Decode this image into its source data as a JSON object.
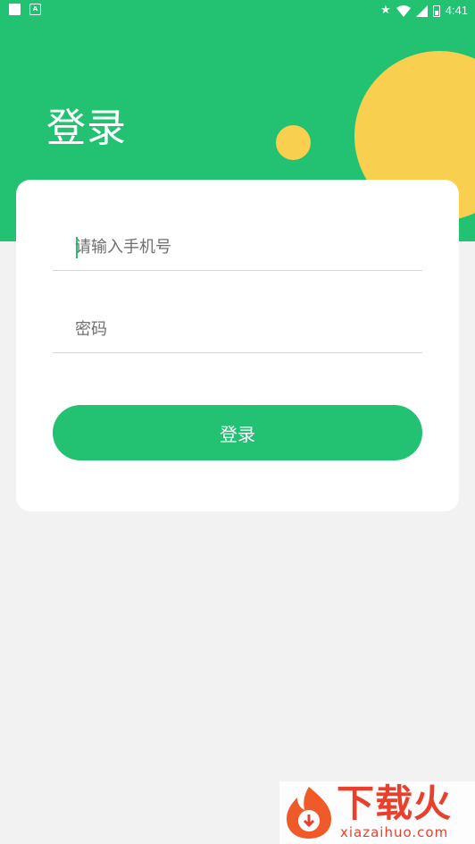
{
  "statusbar": {
    "time": "4:41",
    "icons": [
      "notification-square-icon",
      "accessibility-a-icon",
      "star-icon",
      "wifi-icon",
      "signal-icon",
      "battery-icon"
    ]
  },
  "header": {
    "title": "登录"
  },
  "form": {
    "phone_placeholder": "请输入手机号",
    "phone_value": "",
    "password_placeholder": "密码",
    "password_value": "",
    "login_label": "登录"
  },
  "watermark": {
    "text": "下载火",
    "domain": "xiazaihuo.com"
  },
  "colors": {
    "primary": "#22c272",
    "accent_yellow": "#f8cf4f",
    "background": "#f2f2f2",
    "watermark_red": "#e8402a"
  }
}
